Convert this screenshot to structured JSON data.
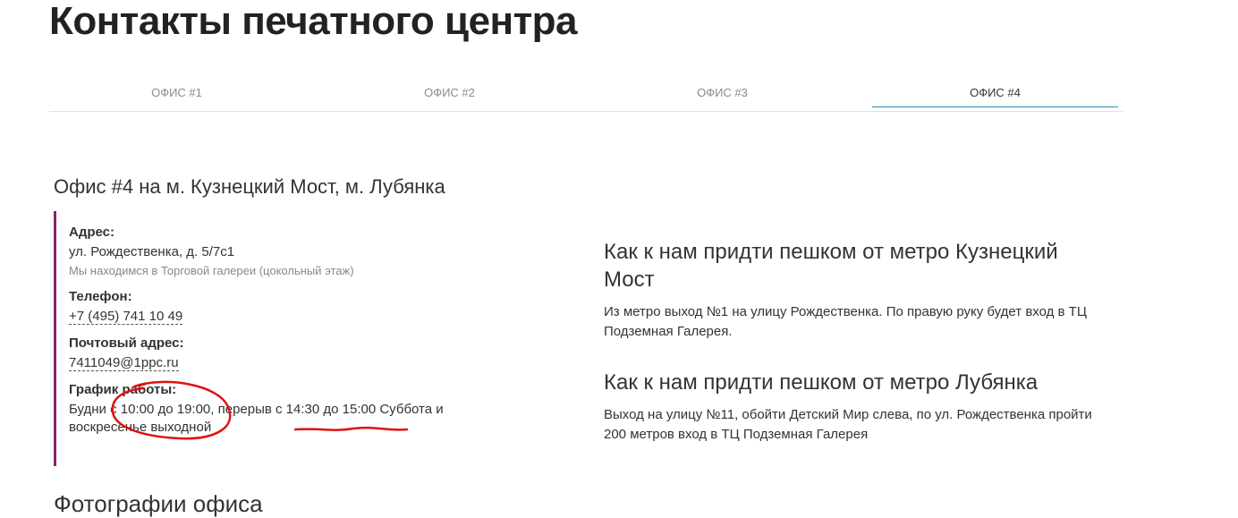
{
  "page": {
    "title": "Контакты печатного центра"
  },
  "tabs": [
    {
      "label": "ОФИС #1",
      "active": false
    },
    {
      "label": "ОФИС #2",
      "active": false
    },
    {
      "label": "ОФИС #3",
      "active": false
    },
    {
      "label": "ОФИС #4",
      "active": true
    }
  ],
  "office": {
    "title": "Офис #4 на м. Кузнецкий Мост, м. Лубянка",
    "address_label": "Адрес:",
    "address": "ул. Рождественка, д. 5/7с1",
    "address_note": "Мы находимся в Торговой галереи (цокольный этаж)",
    "phone_label": "Телефон:",
    "phone": "+7 (495) 741 10 49",
    "email_label": "Почтовый адрес:",
    "email": "7411049@1ppc.ru",
    "schedule_label": "График работы:",
    "schedule": "Будни с 10:00 до 19:00, перерыв с 14:30 до 15:00 Суббота и воскресенье выходной"
  },
  "directions": [
    {
      "title": "Как к нам придти пешком от метро Кузнецкий Мост",
      "text": "Из метро выход №1 на улицу Рождественка. По правую руку будет вход в ТЦ Подземная Галерея."
    },
    {
      "title": "Как к нам придти пешком от метро Лубянка",
      "text": "Выход на улицу №11, обойти Детский Мир слева, по ул. Рождественка пройти 200 метров вход в ТЦ Подземная Галерея"
    }
  ],
  "photos": {
    "title": "Фотографии офиса"
  },
  "colors": {
    "accent_border": "#8a1f6d",
    "active_tab_line": "#2b8fb1",
    "annotation": "#e01010"
  }
}
